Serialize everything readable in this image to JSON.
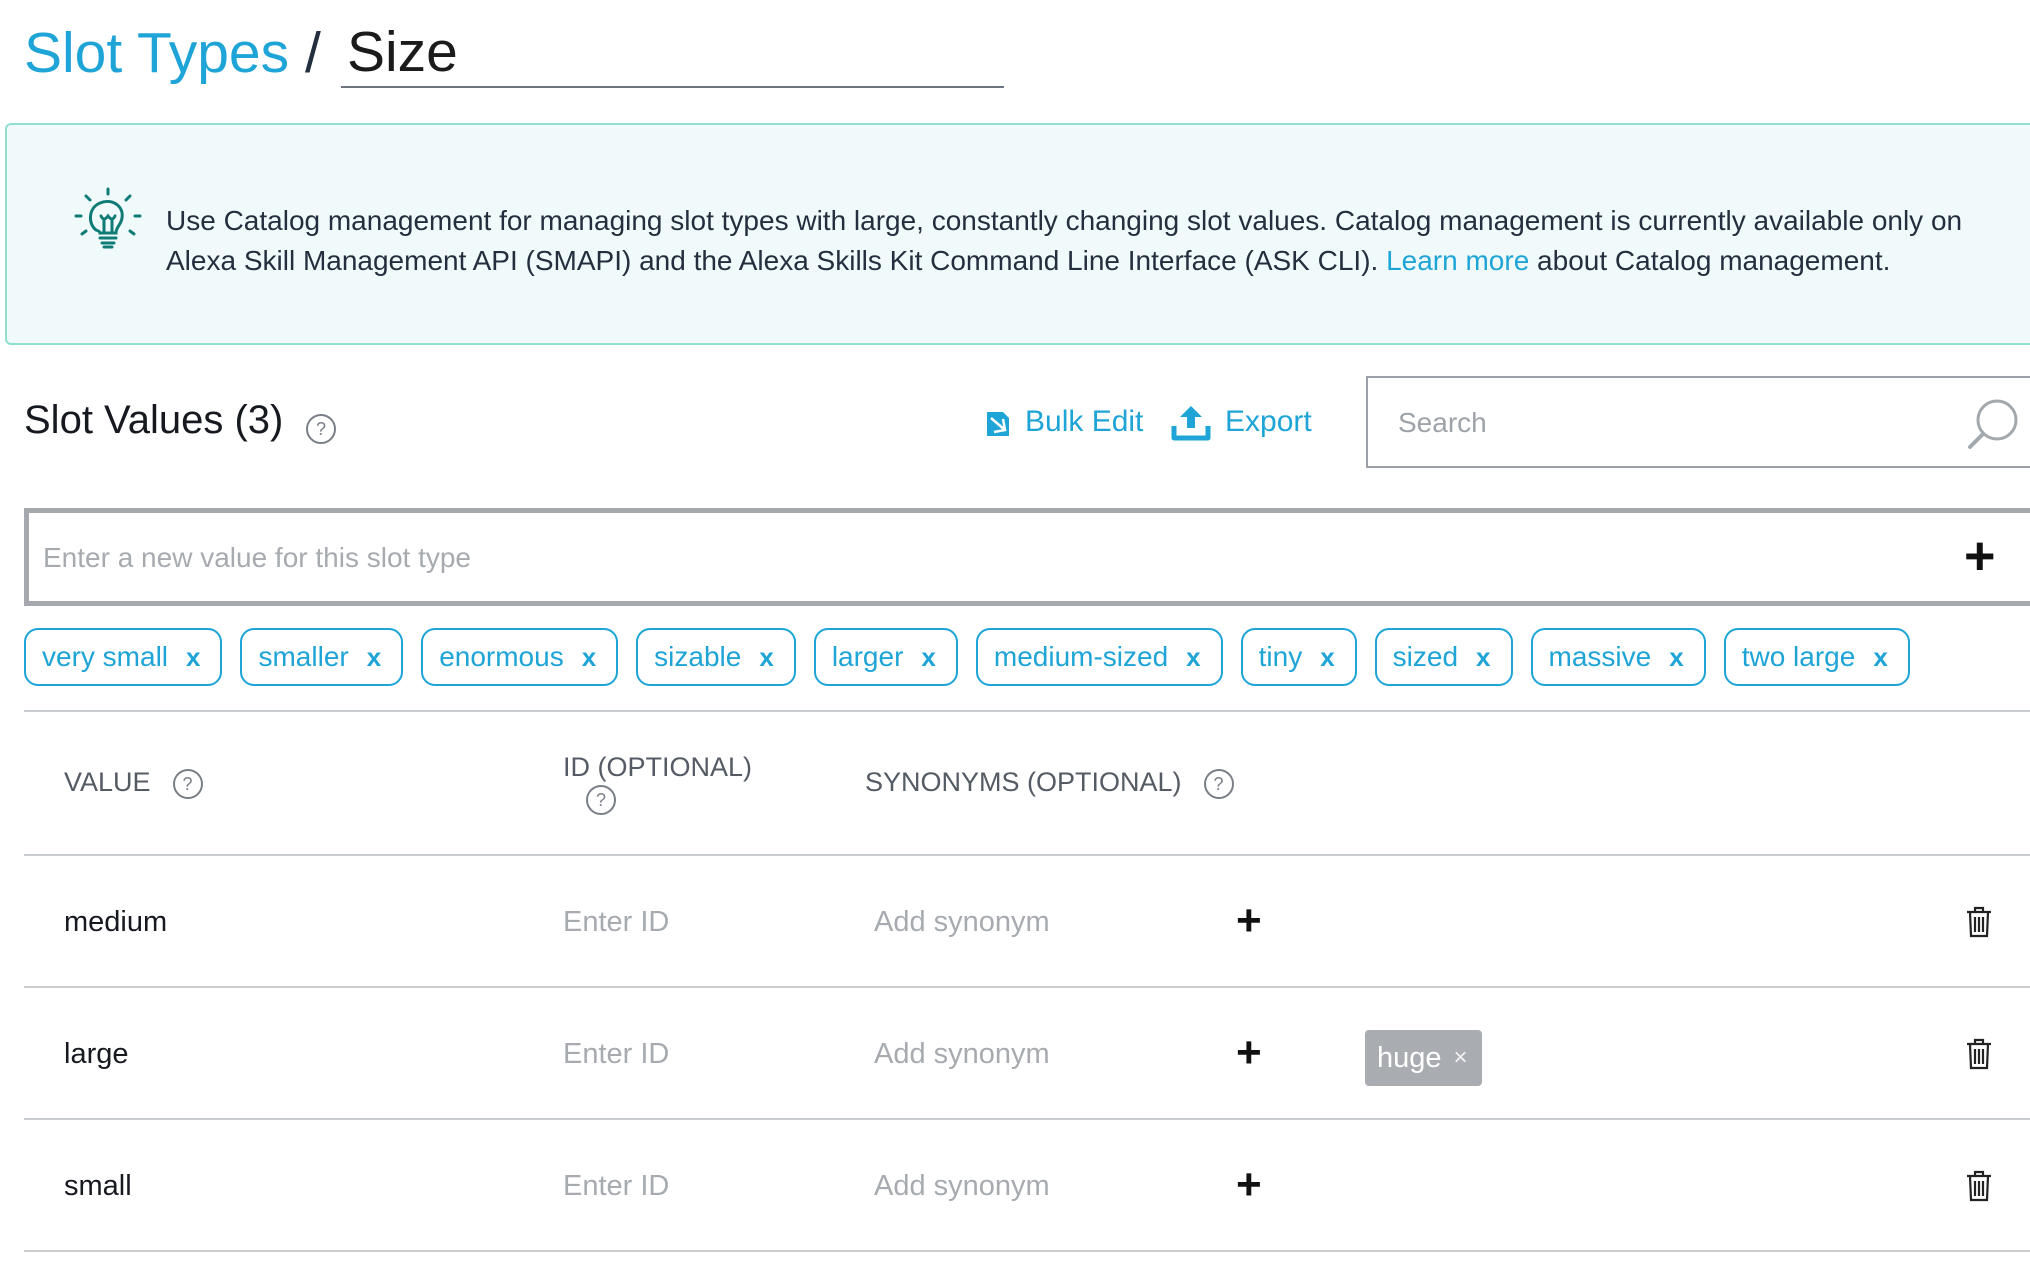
{
  "breadcrumb": {
    "parent": "Slot Types",
    "separator": "/",
    "current": "Size"
  },
  "banner": {
    "text_before": "Use Catalog management for managing slot types with large, constantly changing slot values. Catalog management is currently available only on Alexa Skill Management API (SMAPI) and the Alexa Skills Kit Command Line Interface (ASK CLI). ",
    "link": "Learn more",
    "text_after": " about Catalog management.",
    "icon": "lightbulb-icon"
  },
  "slot_values": {
    "title": "Slot Values (3)",
    "help": "?",
    "bulk_edit": "Bulk Edit",
    "export": "Export",
    "search_placeholder": "Search",
    "new_value_placeholder": "Enter a new value for this slot type",
    "add_symbol": "+"
  },
  "suggestions": [
    {
      "label": "very small",
      "remove": "x"
    },
    {
      "label": "smaller",
      "remove": "x"
    },
    {
      "label": "enormous",
      "remove": "x"
    },
    {
      "label": "sizable",
      "remove": "x"
    },
    {
      "label": "larger",
      "remove": "x"
    },
    {
      "label": "medium-sized",
      "remove": "x"
    },
    {
      "label": "tiny",
      "remove": "x"
    },
    {
      "label": "sized",
      "remove": "x"
    },
    {
      "label": "massive",
      "remove": "x"
    },
    {
      "label": "two large",
      "remove": "x"
    }
  ],
  "table": {
    "columns": {
      "value": "VALUE",
      "id": "ID (OPTIONAL)",
      "synonyms": "SYNONYMS (OPTIONAL)"
    },
    "id_placeholder": "Enter ID",
    "synonym_placeholder": "Add synonym",
    "rows": [
      {
        "value": "medium",
        "synonyms": []
      },
      {
        "value": "large",
        "synonyms": [
          "huge"
        ]
      },
      {
        "value": "small",
        "synonyms": []
      }
    ],
    "synonym_remove": "×"
  },
  "colors": {
    "accent": "#1ea4d6",
    "banner_bg": "#f1fafb",
    "banner_border": "#8fe0cf",
    "synonym_chip": "#a9adb2"
  }
}
